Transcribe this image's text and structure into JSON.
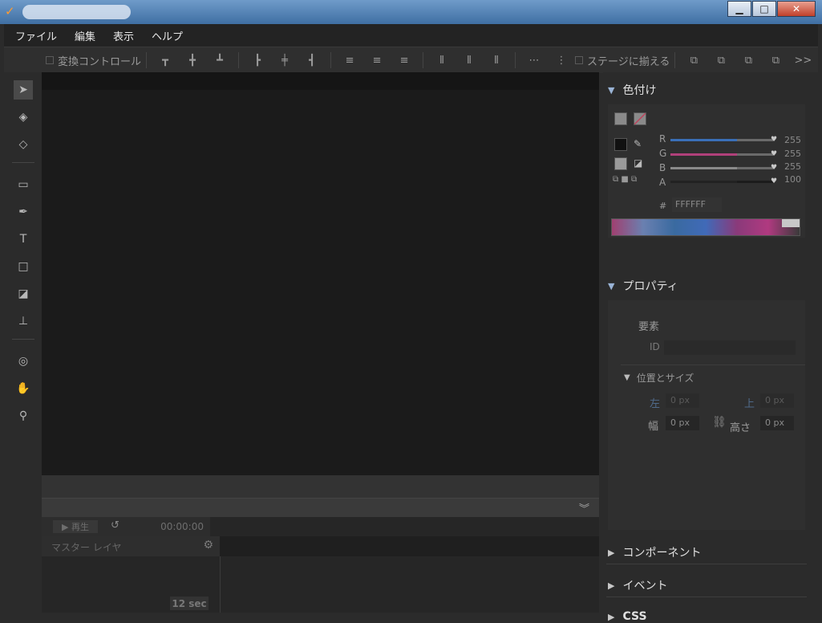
{
  "menu": [
    "ファイル",
    "編集",
    "表示",
    "ヘルプ"
  ],
  "toolbar": {
    "transform_control": "変換コントロール",
    "align_to_stage": "ステージに揃える",
    "more": ">>"
  },
  "panels": {
    "coloring": {
      "title": "色付け",
      "channels": [
        {
          "label": "R",
          "value": "255",
          "fraction": 1.0,
          "color": "#3a6fb8"
        },
        {
          "label": "G",
          "value": "255",
          "fraction": 1.0,
          "color": "#b0407a"
        },
        {
          "label": "B",
          "value": "255",
          "fraction": 1.0,
          "color": "#8a8a8a"
        },
        {
          "label": "A",
          "value": "100",
          "fraction": 1.0,
          "color": "#222222"
        }
      ],
      "hash": "#",
      "hex": "FFFFFF"
    },
    "properties": {
      "title": "プロパティ",
      "element_label": "要素",
      "id_label": "ID",
      "pos_size_title": "位置とサイズ",
      "left_label": "左",
      "left_value": "0",
      "top_label": "上",
      "top_value": "0",
      "width_label": "幅",
      "width_value": "0",
      "height_label": "高さ",
      "height_value": "0",
      "unit": "px"
    },
    "components": "コンポーネント",
    "events": "イベント",
    "css": "CSS"
  },
  "timeline": {
    "play": "再生",
    "timecode": "00:00:00",
    "master_layer": "マスター レイヤ",
    "duration": "12 sec"
  }
}
